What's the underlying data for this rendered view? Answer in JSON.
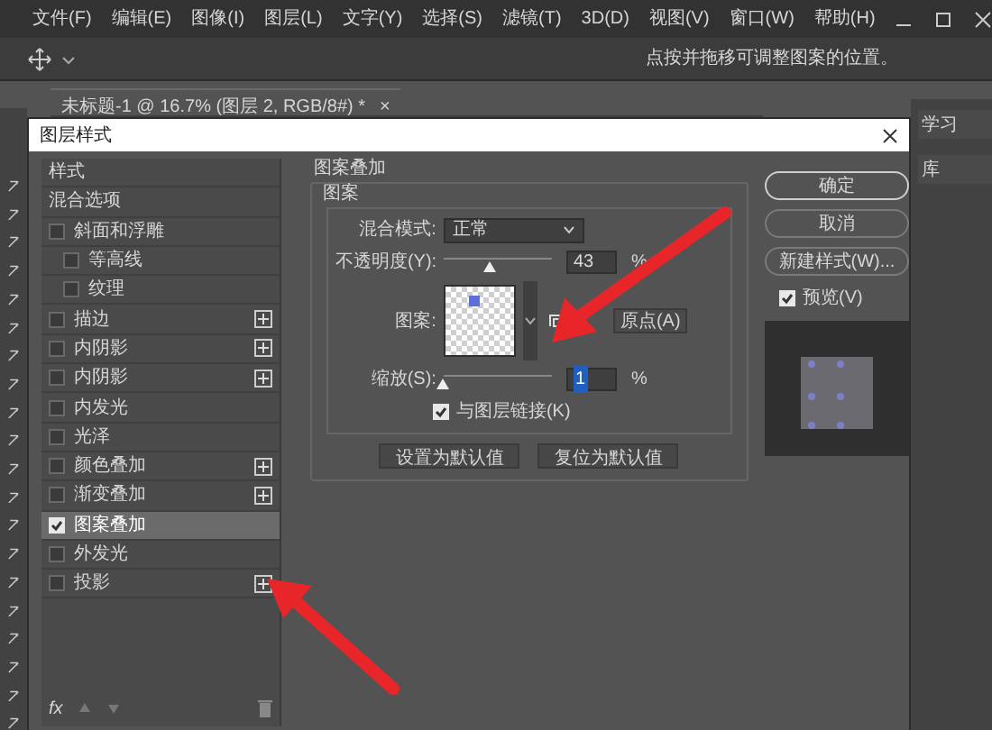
{
  "menu_bar": {
    "items": [
      "文件(F)",
      "编辑(E)",
      "图像(I)",
      "图层(L)",
      "文字(Y)",
      "选择(S)",
      "滤镜(T)",
      "3D(D)",
      "视图(V)",
      "窗口(W)",
      "帮助(H)"
    ]
  },
  "options_bar": {
    "hint": "点按并拖移可调整图案的位置。"
  },
  "document_tab": {
    "title": "未标题-1 @ 16.7% (图层 2, RGB/8#) *",
    "close": "×"
  },
  "right_panel": {
    "items": [
      "学习",
      "库"
    ]
  },
  "dialog": {
    "title": "图层样式",
    "styles": [
      {
        "label": "样式",
        "kind": "header",
        "selected": false
      },
      {
        "label": "混合选项",
        "kind": "header",
        "selected": false
      },
      {
        "label": "斜面和浮雕",
        "kind": "effect",
        "checked": false,
        "add": false,
        "selected": false,
        "children": [
          {
            "label": "等高线",
            "kind": "effect",
            "checked": false,
            "add": false,
            "selected": false
          },
          {
            "label": "纹理",
            "kind": "effect",
            "checked": false,
            "add": false,
            "selected": false
          }
        ]
      },
      {
        "label": "描边",
        "kind": "effect",
        "checked": false,
        "add": true,
        "selected": false
      },
      {
        "label": "内阴影",
        "kind": "effect",
        "checked": false,
        "add": true,
        "selected": false
      },
      {
        "label": "内阴影",
        "kind": "effect",
        "checked": false,
        "add": true,
        "selected": false
      },
      {
        "label": "内发光",
        "kind": "effect",
        "checked": false,
        "add": false,
        "selected": false
      },
      {
        "label": "光泽",
        "kind": "effect",
        "checked": false,
        "add": false,
        "selected": false
      },
      {
        "label": "颜色叠加",
        "kind": "effect",
        "checked": false,
        "add": true,
        "selected": false
      },
      {
        "label": "渐变叠加",
        "kind": "effect",
        "checked": false,
        "add": true,
        "selected": false
      },
      {
        "label": "图案叠加",
        "kind": "effect",
        "checked": true,
        "add": false,
        "selected": true
      },
      {
        "label": "外发光",
        "kind": "effect",
        "checked": false,
        "add": false,
        "selected": false
      },
      {
        "label": "投影",
        "kind": "effect",
        "checked": false,
        "add": true,
        "selected": false
      }
    ],
    "list_footer": {
      "fx": "fx"
    },
    "section": {
      "title": "图案叠加",
      "group": "图案",
      "blend_mode": {
        "label": "混合模式:",
        "value": "正常"
      },
      "opacity": {
        "label": "不透明度(Y):",
        "level": 0.43,
        "value": "43",
        "unit": "%"
      },
      "pattern": {
        "label": "图案:",
        "snap_button": "原点(A)"
      },
      "scale": {
        "label": "缩放(S):",
        "level": 0,
        "value": "1",
        "unit": "%"
      },
      "link": {
        "label": "与图层链接(K)",
        "checked": true
      },
      "buttons": [
        "设置为默认值",
        "复位为默认值"
      ]
    },
    "actions": [
      {
        "label": "确定",
        "default": true
      },
      {
        "label": "取消",
        "default": false
      },
      {
        "label": "新建样式(W)...",
        "default": false
      }
    ],
    "preview": {
      "label": "预览(V)",
      "checked": true
    }
  }
}
